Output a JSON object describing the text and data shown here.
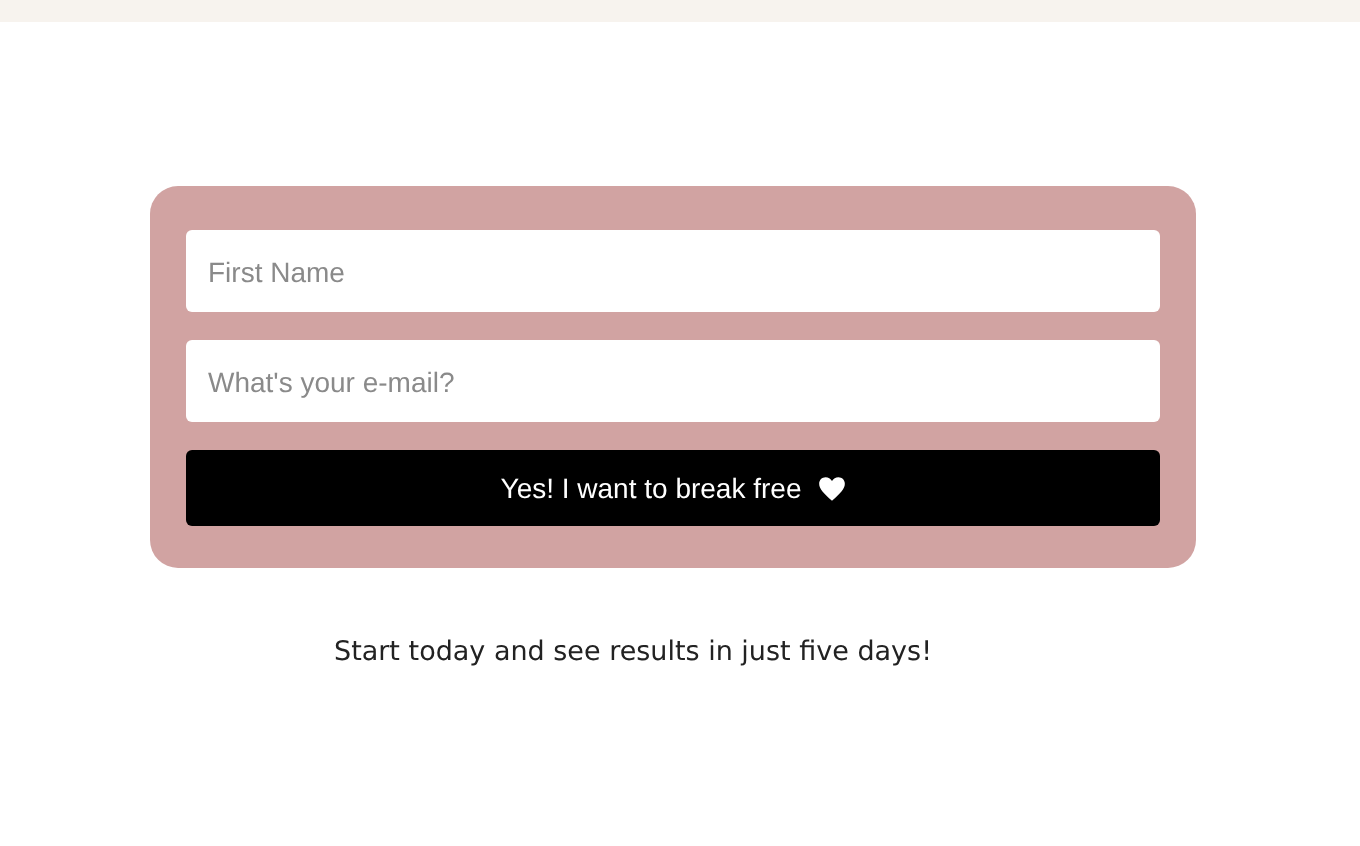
{
  "form": {
    "fields": [
      {
        "placeholder": "First Name"
      },
      {
        "placeholder": "What's your e-mail?"
      }
    ],
    "button": {
      "label": "Yes! I want to break free"
    }
  },
  "caption": "Start today and see results in just five days!"
}
